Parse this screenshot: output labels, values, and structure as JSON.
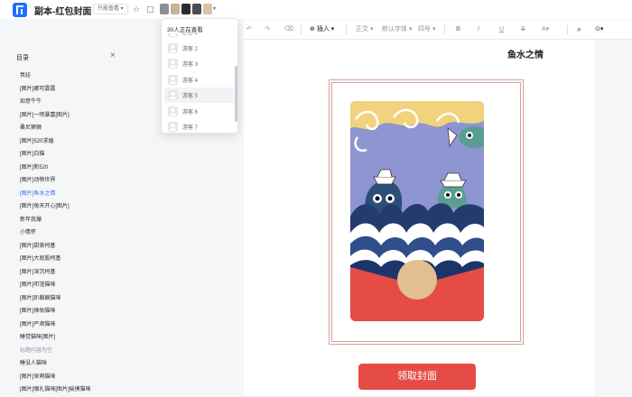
{
  "header": {
    "title": "副本-红包封面",
    "permission_badge": "只能查看 ▾",
    "icons": [
      "star-icon",
      "copy-icon"
    ],
    "avatar_more": "▾"
  },
  "toolbar": {
    "insert_label": "插入",
    "style_label": "正文",
    "font_label": "默认字体",
    "size_label": "四号",
    "bold": "B",
    "italic": "I",
    "underline": "U",
    "strike": "S"
  },
  "sidebar": {
    "title": "目录",
    "items": [
      {
        "label": "氛娃",
        "state": "normal"
      },
      {
        "label": "[图片]娜可露露",
        "state": "normal"
      },
      {
        "label": "如意牛牛",
        "state": "normal"
      },
      {
        "label": "[图片]一喷暴富[图片]",
        "state": "normal"
      },
      {
        "label": "桑尼狮狮",
        "state": "normal"
      },
      {
        "label": "[图片]520求婚",
        "state": "normal"
      },
      {
        "label": "[图片]白猫",
        "state": "normal"
      },
      {
        "label": "[图片]新520",
        "state": "normal"
      },
      {
        "label": "[图片]动物世界",
        "state": "normal"
      },
      {
        "label": "[图片]鱼水之情",
        "state": "active"
      },
      {
        "label": "[图片]每天开心[图片]",
        "state": "normal"
      },
      {
        "label": "新年我爆",
        "state": "normal"
      },
      {
        "label": "小情怀",
        "state": "normal"
      },
      {
        "label": "[图片]甜美柯基",
        "state": "normal"
      },
      {
        "label": "[图片]大屁股柯基",
        "state": "normal"
      },
      {
        "label": "[图片]深沉柯基",
        "state": "normal"
      },
      {
        "label": "[图片]叩渣猫咪",
        "state": "normal"
      },
      {
        "label": "[图片]趴躺躺猫咪",
        "state": "normal"
      },
      {
        "label": "[图片]捧佑猫咪",
        "state": "normal"
      },
      {
        "label": "[图片]严肃猫咪",
        "state": "normal"
      },
      {
        "label": "睡觉猫咪[图片]",
        "state": "normal"
      },
      {
        "label": "标题内容为空",
        "state": "muted"
      },
      {
        "label": "睡没人猫咪",
        "state": "normal"
      },
      {
        "label": "[图片]呆萌猫咪",
        "state": "normal"
      },
      {
        "label": "[图片]眼扎猫咪[图片]偷摸猫咪",
        "state": "normal"
      }
    ]
  },
  "main": {
    "heading": "鱼水之情",
    "cover_button": "领取封面"
  },
  "viewers": {
    "title": "30人正在查看",
    "items": [
      "游客 1",
      "游客 2",
      "游客 3",
      "游客 4",
      "游客 5",
      "游客 6",
      "游客 7"
    ],
    "hover_index": 4
  },
  "colors": {
    "accent": "#3370ff",
    "logo": "#1f6fff",
    "red_envelope": "#e44c45",
    "frame": "#d7a09a"
  }
}
